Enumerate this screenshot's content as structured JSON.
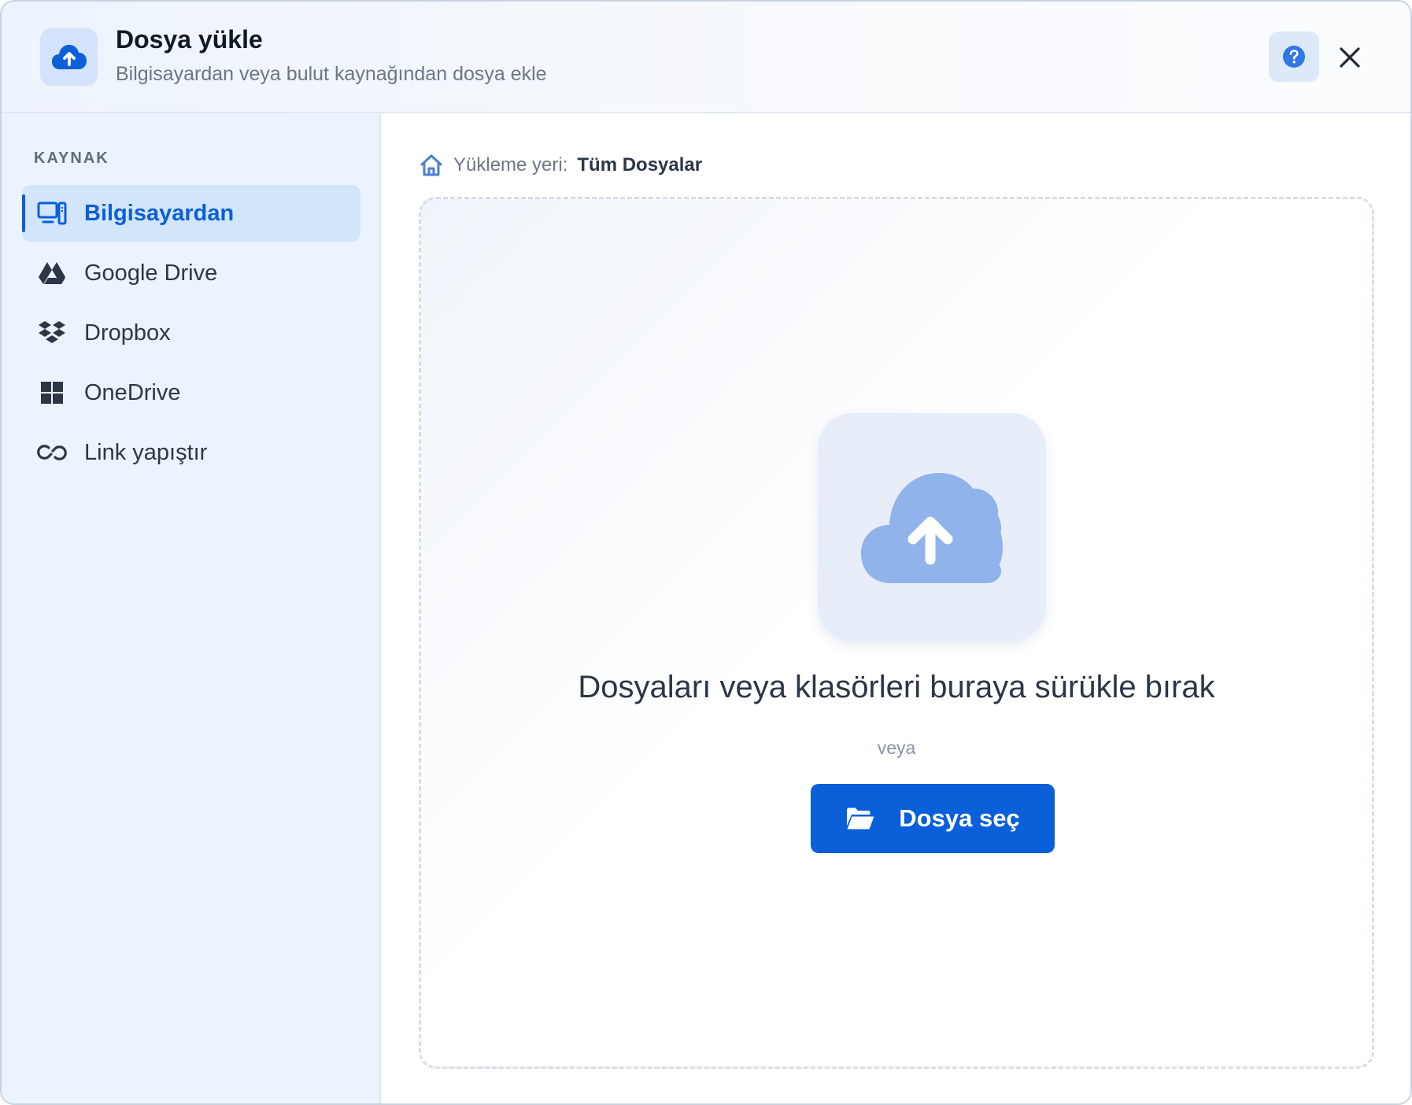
{
  "header": {
    "title": "Dosya yükle",
    "subtitle": "Bilgisayardan veya bulut kaynağından dosya ekle",
    "icon": "cloud-upload-icon",
    "help_icon": "help-icon",
    "close_icon": "close-icon"
  },
  "sidebar": {
    "heading": "KAYNAK",
    "active_index": 0,
    "items": [
      {
        "label": "Bilgisayardan",
        "icon": "computer-icon",
        "active": true
      },
      {
        "label": "Google Drive",
        "icon": "google-drive-icon",
        "active": false
      },
      {
        "label": "Dropbox",
        "icon": "dropbox-icon",
        "active": false
      },
      {
        "label": "OneDrive",
        "icon": "onedrive-icon",
        "active": false
      },
      {
        "label": "Link yapıştır",
        "icon": "link-icon",
        "active": false
      }
    ]
  },
  "main": {
    "breadcrumb": {
      "label": "Yükleme yeri:",
      "value": "Tüm Dosyalar",
      "icon": "home-icon"
    },
    "dropzone": {
      "title": "Dosyaları veya klasörleri buraya sürükle bırak",
      "or_text": "veya",
      "button_label": "Dosya seç",
      "button_icon": "folder-open-icon",
      "illustration_icon": "cloud-upload-icon"
    }
  },
  "colors": {
    "accent": "#0b5fd8",
    "sidebar_bg": "#ebf4fe",
    "active_item_bg": "#d2e5fb",
    "illustration_cloud": "#8fb3ea"
  }
}
